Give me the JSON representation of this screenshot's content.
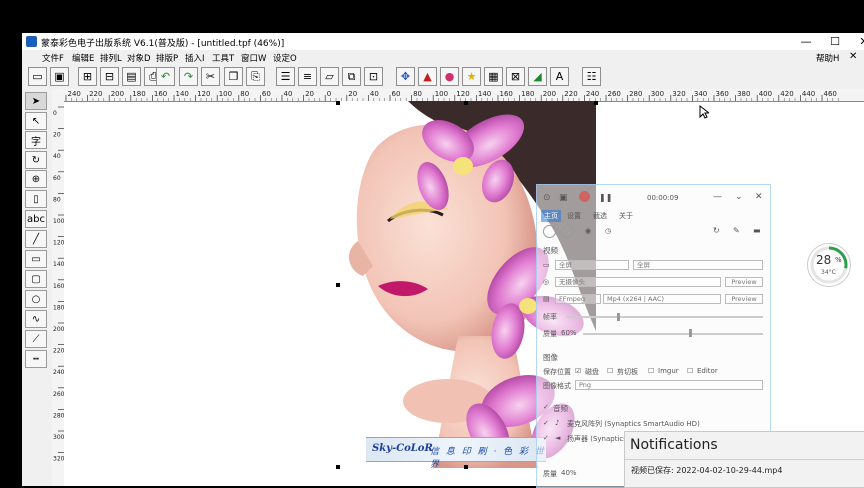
{
  "window": {
    "title": "蒙泰彩色电子出版系统 V6.1(普及版) - [untitled.tpf (46%)]",
    "controls": {
      "minimize": "—",
      "maximize": "☐",
      "close": "✕"
    },
    "help_label": "帮助H"
  },
  "menu": [
    "文件F",
    "编辑E",
    "排列L",
    "对象D",
    "排版P",
    "插入I",
    "工具T",
    "窗口W",
    "设定O"
  ],
  "ruler": {
    "h_ticks": [
      "240",
      "220",
      "200",
      "180",
      "160",
      "140",
      "120",
      "100",
      "80",
      "60",
      "40",
      "20",
      "0",
      "20",
      "40",
      "60",
      "80",
      "100",
      "120",
      "140",
      "160",
      "180",
      "200",
      "220",
      "240",
      "260",
      "280",
      "300",
      "320",
      "340",
      "360",
      "380",
      "400",
      "420",
      "440",
      "460"
    ],
    "v_ticks": [
      "0",
      "20",
      "40",
      "60",
      "80",
      "100",
      "120",
      "140",
      "160",
      "180",
      "200",
      "220",
      "240",
      "260",
      "280",
      "300",
      "320"
    ]
  },
  "left_tools": [
    "select",
    "direct-select",
    "text",
    "rotate",
    "zoom",
    "page",
    "abc",
    "line",
    "rectangle",
    "rounded-rectangle",
    "ellipse",
    "curve",
    "polyline",
    "table"
  ],
  "banner": {
    "logo": "Sky-CoLoR",
    "slogan": "信 息 印 刷 · 色 彩 世 界"
  },
  "recorder": {
    "timer": "00:00:09",
    "tabs": [
      "主页",
      "设置",
      "截选",
      "关于"
    ],
    "section_video": "视频",
    "screen_option": "全屏",
    "screen_option2": "全屏",
    "webcam": "无摄像头",
    "format": "FFmpeg",
    "codec": "Mp4 (x264 | AAC)",
    "preview": "Preview",
    "fps_label": "帧率",
    "quality_label": "质量",
    "quality_value": "60%",
    "section_image": "图像",
    "save_to": "保存位置",
    "disk": "磁盘",
    "clipboard": "剪切板",
    "imgur": "Imgur",
    "editor": "Editor",
    "image_format_label": "图像格式",
    "image_format": "Png",
    "section_audio": "音频",
    "mic": "麦克风阵列 (Synaptics SmartAudio HD)",
    "speaker": "扬声器 (Synaptics S",
    "audio_quality_label": "质量",
    "audio_quality_value": "40%"
  },
  "battery": {
    "percent": "28",
    "unit": "%",
    "temp": "34°C",
    "level": 0.28
  },
  "notification": {
    "title": "Notifications",
    "body": "视频已保存: 2022-04-02-10-29-44.mp4"
  },
  "colors": {
    "accent": "#2aa04a",
    "recorder_red": "#e05050",
    "title_blue": "#1d5fb8"
  }
}
